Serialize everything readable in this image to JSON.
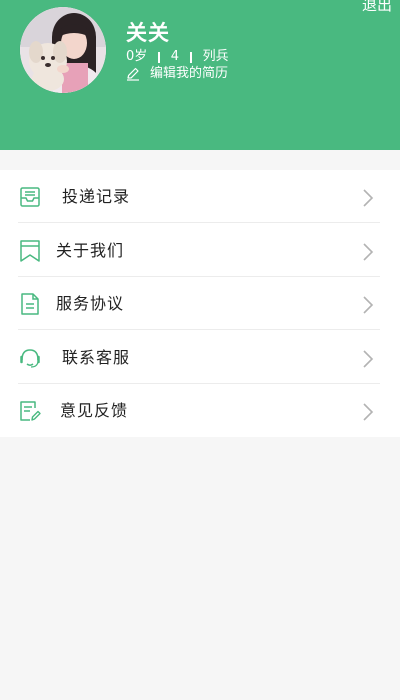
{
  "header": {
    "logout_label": "退出",
    "user_name": "关关",
    "age": "0岁",
    "level": "4",
    "rank": "列兵",
    "edit_label": "编辑我的简历",
    "background_color": "#49b980"
  },
  "menu": {
    "items": [
      {
        "label": "投递记录",
        "icon": "inbox-tray-icon"
      },
      {
        "label": "关于我们",
        "icon": "bookmark-icon"
      },
      {
        "label": "服务协议",
        "icon": "document-icon"
      },
      {
        "label": "联系客服",
        "icon": "headset-icon"
      },
      {
        "label": "意见反馈",
        "icon": "feedback-edit-icon"
      }
    ]
  },
  "colors": {
    "accent": "#49b980",
    "icon": "#49b980",
    "text": "#222222",
    "chevron": "#b3b3b3",
    "background": "#f6f6f6"
  }
}
